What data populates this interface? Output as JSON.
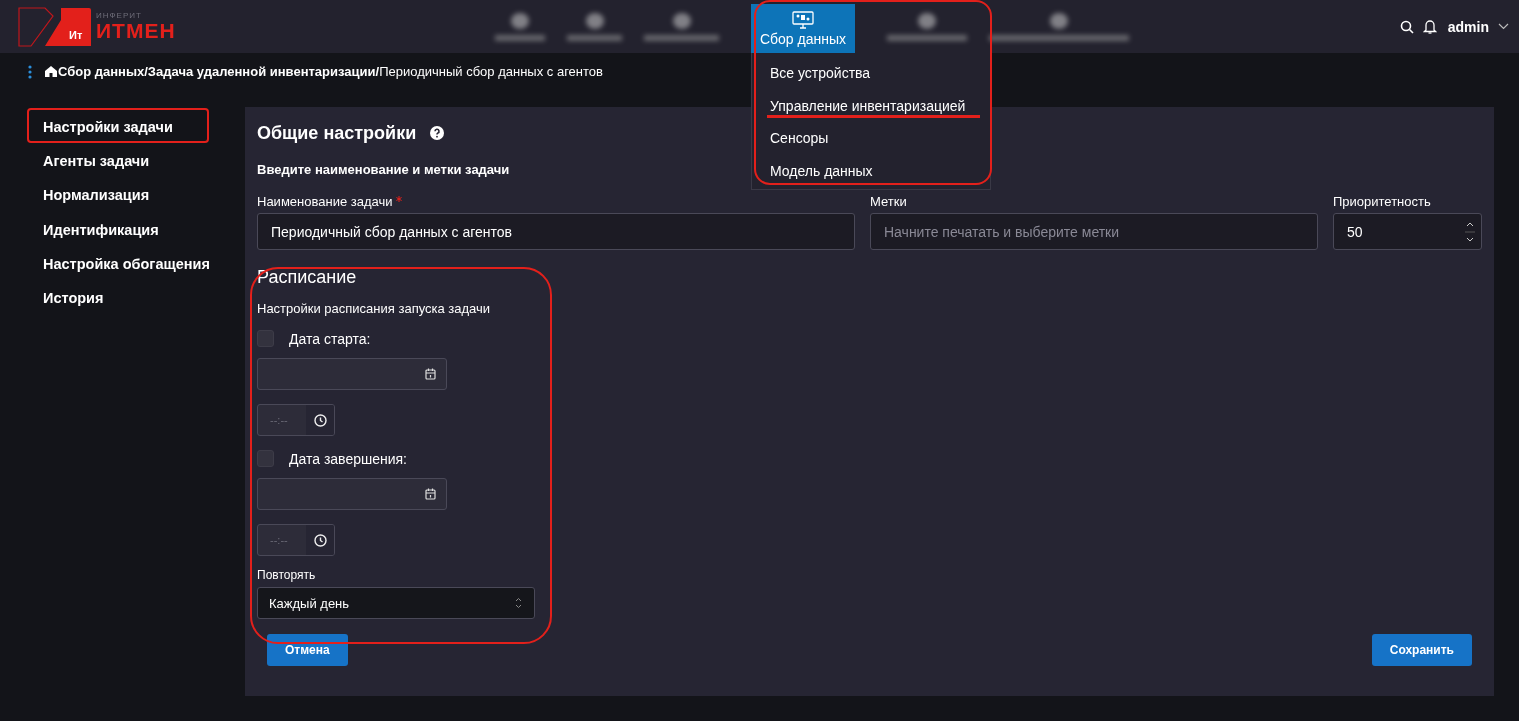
{
  "header": {
    "logo_small": "ИНФЕРИТ",
    "logo_big": "ИТМЕН",
    "logo_badge": "Ит",
    "user": "admin"
  },
  "nav": [
    {
      "label": "Сбор данных",
      "selected": true
    }
  ],
  "dropdown": [
    "Все устройства",
    "Управление инвентаризацией",
    "Сенсоры",
    "Модель данных"
  ],
  "breadcrumb": "**Сбор данных/Задача удаленной инвентаризации/**Периодичный сбор данных с агентов",
  "sidebar": [
    {
      "label": "Настройки задачи"
    },
    {
      "label": "Агенты задачи"
    },
    {
      "label": "Нормализация"
    },
    {
      "label": "Идентификация"
    },
    {
      "label": "Настройка обогащения"
    },
    {
      "label": "История"
    }
  ],
  "general": {
    "title": "Общие настройки",
    "subtitle": "Введите наименование и метки задачи",
    "name": {
      "label": "Наименование задачи",
      "required": true,
      "value": "Периодичный сбор данных с агентов"
    },
    "tags": {
      "label": "Метки",
      "placeholder": "Начните печатать и выберите метки"
    },
    "priority": {
      "label": "Приоритетность",
      "value": "50"
    }
  },
  "schedule": {
    "title": "Расписание",
    "subtitle": "Настройки расписания запуска задачи",
    "start": {
      "label": "Дата старта:",
      "checked": false,
      "time_placeholder": "--:--"
    },
    "end": {
      "label": "Дата завершения:",
      "checked": false,
      "time_placeholder": "--:--"
    },
    "repeat": {
      "label": "Повторять",
      "value": "Каждый день"
    }
  },
  "buttons": {
    "cancel": "Отмена",
    "save": "Сохранить"
  }
}
